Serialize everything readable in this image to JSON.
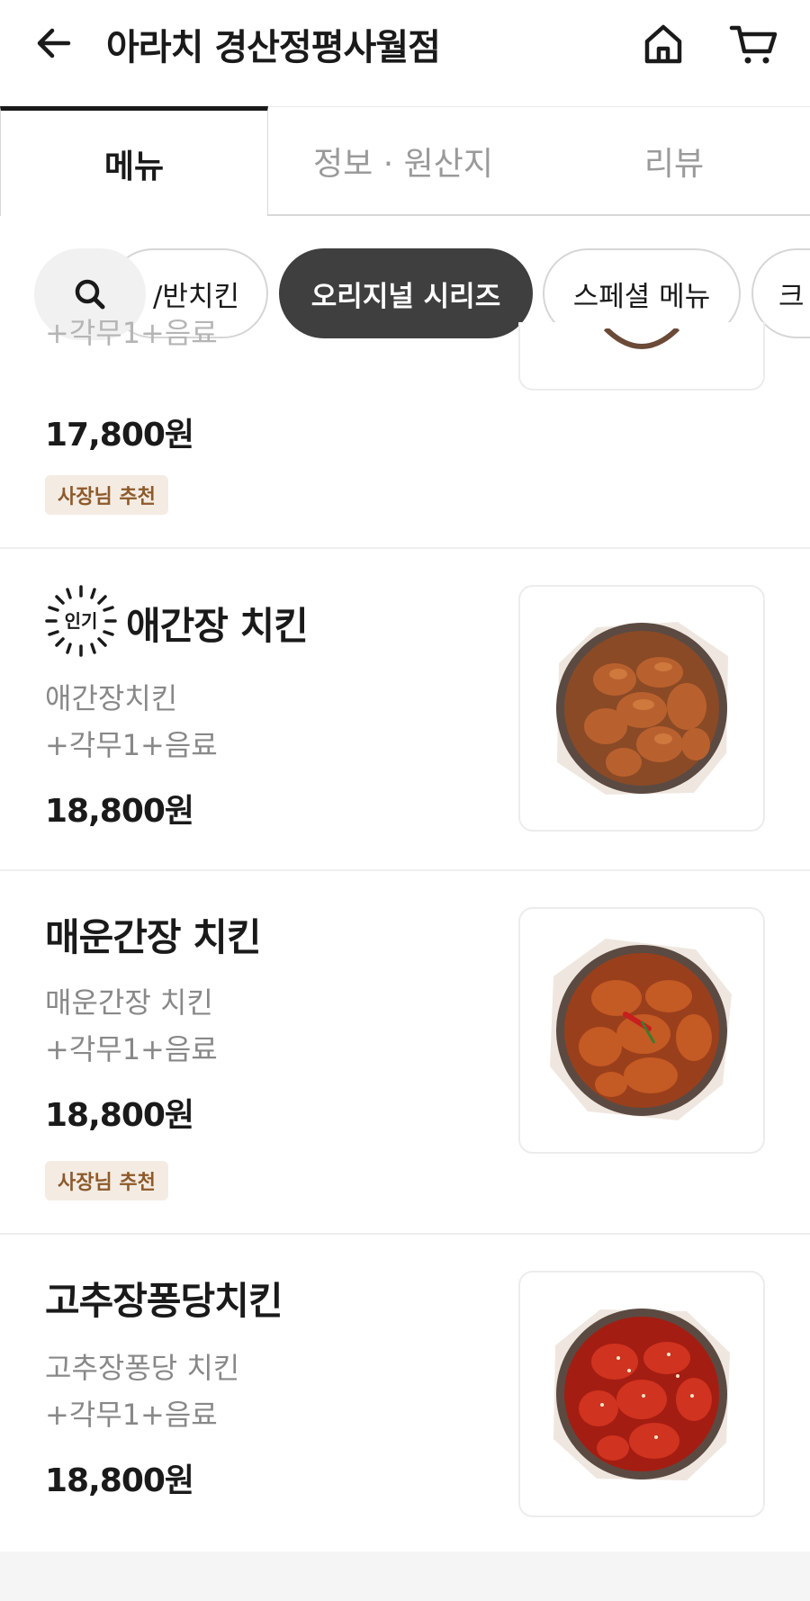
{
  "header": {
    "title": "아라치 경산정평사월점",
    "back_icon": "arrow-left-icon",
    "home_icon": "home-icon",
    "cart_icon": "cart-icon"
  },
  "tabs": [
    {
      "label": "메뉴",
      "active": true
    },
    {
      "label": "정보 · 원산지",
      "active": false
    },
    {
      "label": "리뷰",
      "active": false
    }
  ],
  "categories": {
    "search_icon": "search-icon",
    "items": [
      {
        "label": "/반치킨"
      },
      {
        "label": "오리지널 시리즈",
        "active": true
      },
      {
        "label": "스페셜 메뉴"
      },
      {
        "label": "크"
      }
    ]
  },
  "menu": [
    {
      "desc": "+각무1+음료",
      "price": "17,800원",
      "badge": "사장님 추천"
    },
    {
      "name": "애간장 치킨",
      "popular_label": "인기",
      "desc1": "애간장치킨",
      "desc2": "+각무1+음료",
      "price": "18,800원"
    },
    {
      "name": "매운간장 치킨",
      "desc1": "매운간장 치킨",
      "desc2": "+각무1+음료",
      "price": "18,800원",
      "badge": "사장님 추천"
    },
    {
      "name": "고추장퐁당치킨",
      "desc1": "고추장퐁당 치킨",
      "desc2": "+각무1+음료",
      "price": "18,800원"
    }
  ],
  "colors": {
    "active_chip": "#3f3f3f",
    "badge_bg": "#f4ece3",
    "badge_text": "#8d5a2b",
    "muted_text": "#888888"
  }
}
